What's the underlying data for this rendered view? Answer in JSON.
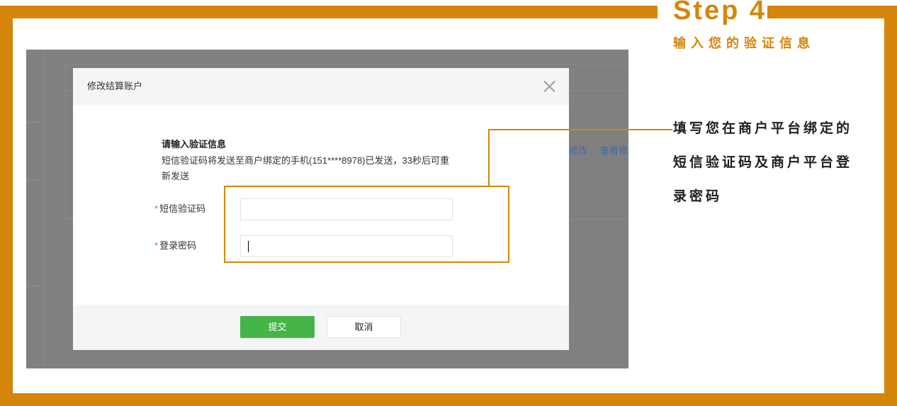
{
  "colors": {
    "accent_orange": "#d4860b",
    "submit_green": "#44b549",
    "required_red": "#e15f5f",
    "overlay_gray": "#808080",
    "link_blue": "#3d6ba3"
  },
  "step": {
    "title": "Step 4",
    "subtitle": "输入您的验证信息"
  },
  "instruction": {
    "lines": [
      "填写您在商户平台绑定的",
      "短信验证码及商户平台登",
      "录密码"
    ]
  },
  "background_page": {
    "links": [
      "修改",
      "查看修"
    ]
  },
  "modal": {
    "title": "修改结算账户",
    "close_icon": "close-icon",
    "heading": "请输入验证信息",
    "message": [
      "短信验证码将发送至商户绑定的手机(151****8978)已发送，33秒后可重",
      "新发送"
    ],
    "fields": [
      {
        "required_mark": "*",
        "label": "短信验证码",
        "value": ""
      },
      {
        "required_mark": "*",
        "label": "登录密码",
        "value": "",
        "focused": true
      }
    ],
    "buttons": {
      "submit": "提交",
      "cancel": "取消"
    }
  }
}
